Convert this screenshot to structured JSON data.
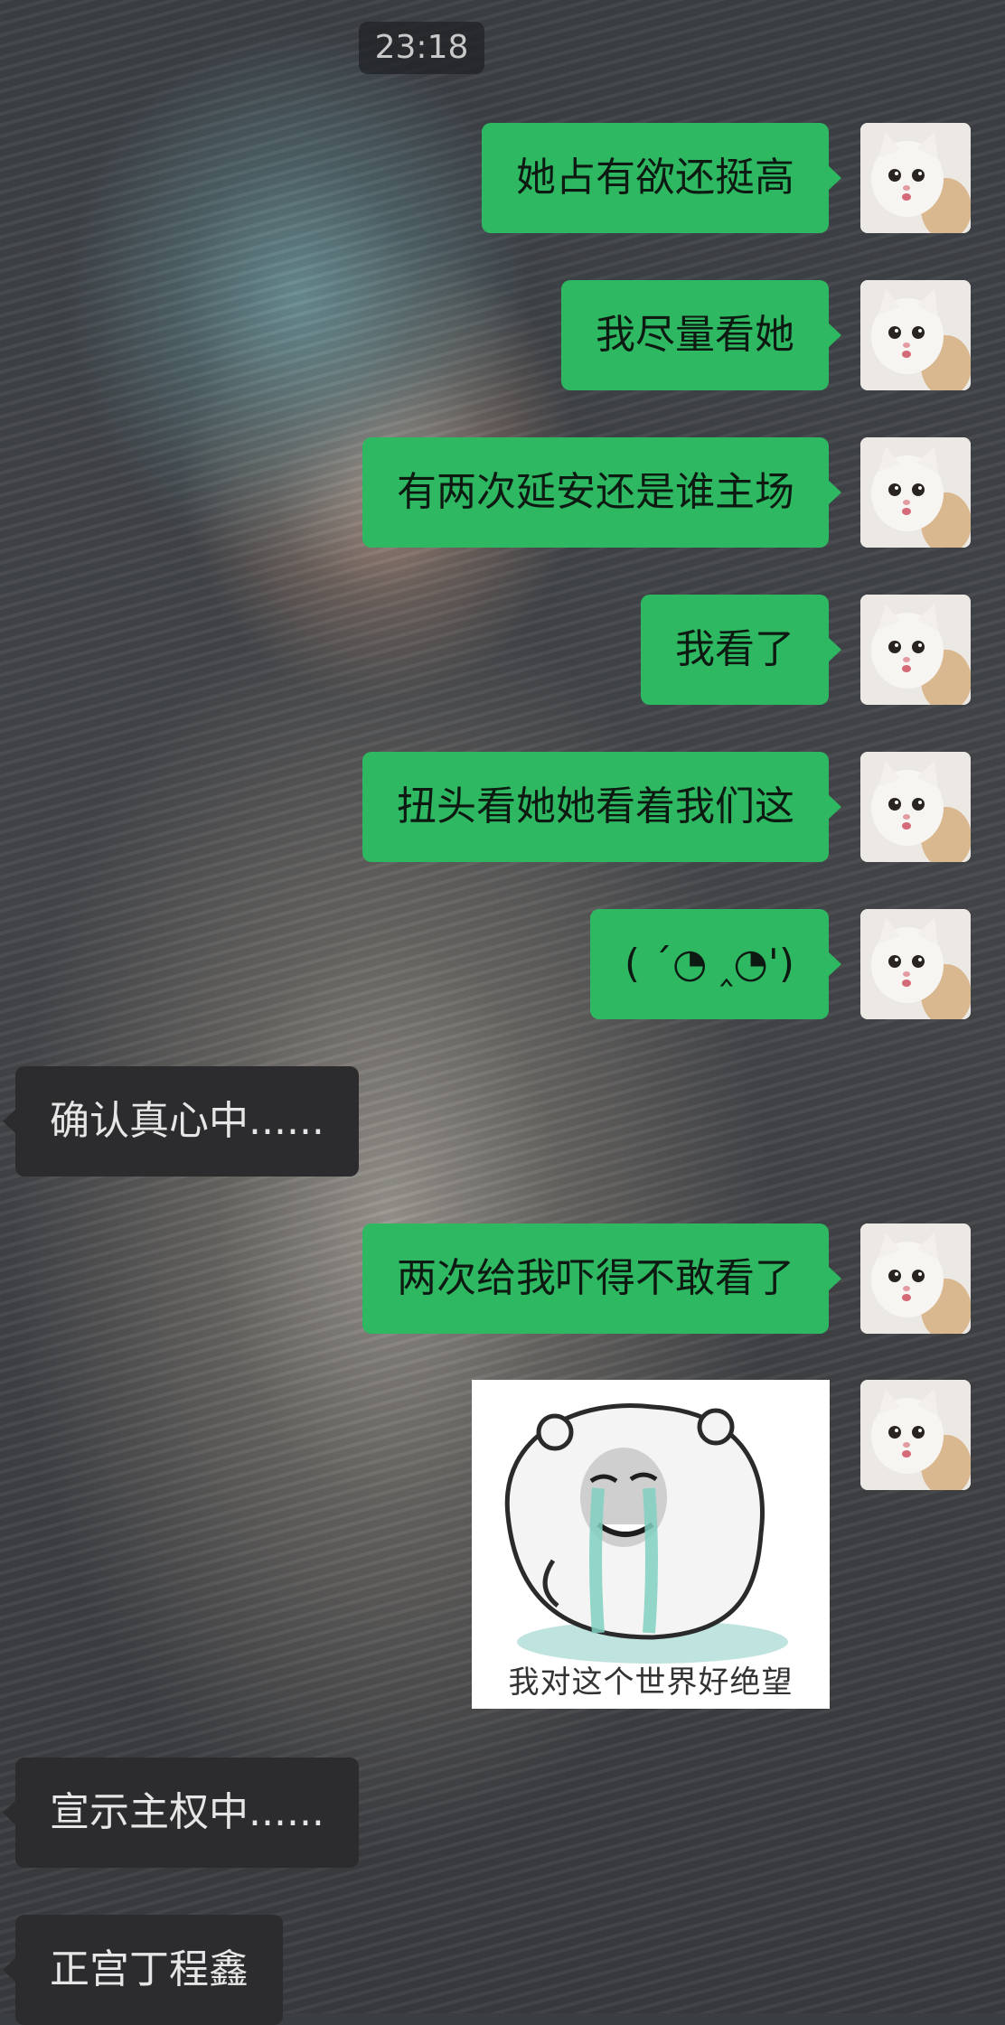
{
  "status": {
    "time": "23:18"
  },
  "messages": [
    {
      "side": "out",
      "text": "她占有欲还挺高"
    },
    {
      "side": "out",
      "text": "我尽量看她"
    },
    {
      "side": "out",
      "text": "有两次延安还是谁主场"
    },
    {
      "side": "out",
      "text": "我看了"
    },
    {
      "side": "out",
      "text": "扭头看她她看着我们这"
    },
    {
      "side": "out",
      "text": "( ˊ◔ ‸◔')"
    },
    {
      "side": "in",
      "text": "确认真心中......"
    },
    {
      "side": "out",
      "text": "两次给我吓得不敢看了"
    },
    {
      "side": "out",
      "type": "sticker",
      "caption": "我对这个世界好绝望"
    },
    {
      "side": "in",
      "text": "宣示主权中......"
    },
    {
      "side": "in",
      "text": "正宫丁程鑫"
    }
  ],
  "avatar": {
    "icon": "kitten-avatar-icon"
  },
  "colors": {
    "outgoing_bubble": "#2fb862",
    "incoming_bubble": "#2c2c2e",
    "time_pill": "#1e2024"
  }
}
